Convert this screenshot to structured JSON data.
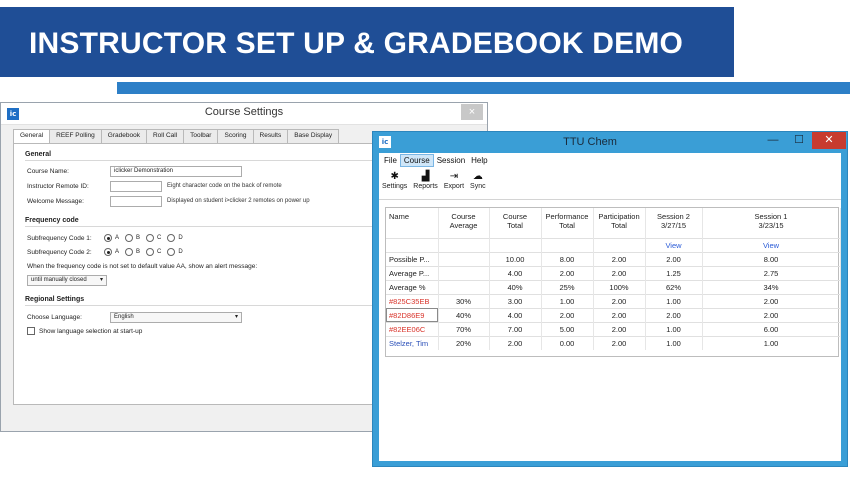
{
  "banner": {
    "title": "INSTRUCTOR SET UP & GRADEBOOK DEMO"
  },
  "course_settings": {
    "window_title": "Course Settings",
    "app_icon": "ic",
    "close_glyph": "×",
    "tabs": [
      "General",
      "REEF Polling",
      "Gradebook",
      "Roll Call",
      "Toolbar",
      "Scoring",
      "Results",
      "Base Display"
    ],
    "general": {
      "section": "General",
      "course_name_label": "Course Name:",
      "course_name_value": "iclicker Demonstration",
      "remote_id_label": "Instructor Remote ID:",
      "remote_id_value": "",
      "remote_id_note": "Eight character code on the back of remote",
      "welcome_label": "Welcome Message:",
      "welcome_value": "",
      "welcome_note": "Displayed on student i>clicker 2 remotes on power up"
    },
    "frequency": {
      "section": "Frequency code",
      "sub1_label": "Subfrequency Code 1:",
      "sub2_label": "Subfrequency Code 2:",
      "options": [
        "A",
        "B",
        "C",
        "D"
      ],
      "sub1_selected": "A",
      "sub2_selected": "A",
      "alert_text": "When the frequency code is not set to default value AA, show an alert message:",
      "alert_select": "until manually closed"
    },
    "regional": {
      "section": "Regional Settings",
      "language_label": "Choose Language:",
      "language_value": "English",
      "show_lang_label": "Show language selection at start-up"
    }
  },
  "ttu": {
    "window_title": "TTU Chem",
    "app_icon": "ic",
    "controls": {
      "minimize": "—",
      "maximize": "☐",
      "close": "✕"
    },
    "menu": [
      "File",
      "Course",
      "Session",
      "Help"
    ],
    "active_menu": "Course",
    "toolbar": [
      {
        "label": "Settings",
        "icon": "gear-icon",
        "glyph": "✱"
      },
      {
        "label": "Reports",
        "icon": "bar-chart-icon",
        "glyph": "▟"
      },
      {
        "label": "Export",
        "icon": "export-icon",
        "glyph": "⇥"
      },
      {
        "label": "Sync",
        "icon": "cloud-sync-icon",
        "glyph": "☁"
      }
    ],
    "grid": {
      "headers": [
        [
          "Name",
          ""
        ],
        [
          "Course",
          "Average"
        ],
        [
          "Course",
          "Total"
        ],
        [
          "Performance",
          "Total"
        ],
        [
          "Participation",
          "Total"
        ],
        [
          "Session 2",
          "3/27/15"
        ],
        [
          "Session 1",
          "3/23/15"
        ]
      ],
      "view_label": "View",
      "rows": [
        {
          "name": "Possible P...",
          "style": "normal",
          "cells": [
            "",
            "10.00",
            "8.00",
            "2.00",
            "2.00",
            "8.00"
          ]
        },
        {
          "name": "Average P...",
          "style": "normal",
          "cells": [
            "",
            "4.00",
            "2.00",
            "2.00",
            "1.25",
            "2.75"
          ]
        },
        {
          "name": "Average %",
          "style": "normal",
          "cells": [
            "",
            "40%",
            "25%",
            "100%",
            "62%",
            "34%"
          ]
        },
        {
          "name": "#825C35EB",
          "style": "red",
          "cells": [
            "30%",
            "3.00",
            "1.00",
            "2.00",
            "1.00",
            "2.00"
          ]
        },
        {
          "name": "#82D86E9",
          "style": "red",
          "cells": [
            "40%",
            "4.00",
            "2.00",
            "2.00",
            "2.00",
            "2.00"
          ]
        },
        {
          "name": "#82EE06C",
          "style": "red",
          "cells": [
            "70%",
            "7.00",
            "5.00",
            "2.00",
            "1.00",
            "6.00"
          ]
        },
        {
          "name": "Stelzer, Tim",
          "style": "blue",
          "cells": [
            "20%",
            "2.00",
            "0.00",
            "2.00",
            "1.00",
            "1.00"
          ]
        }
      ]
    }
  }
}
